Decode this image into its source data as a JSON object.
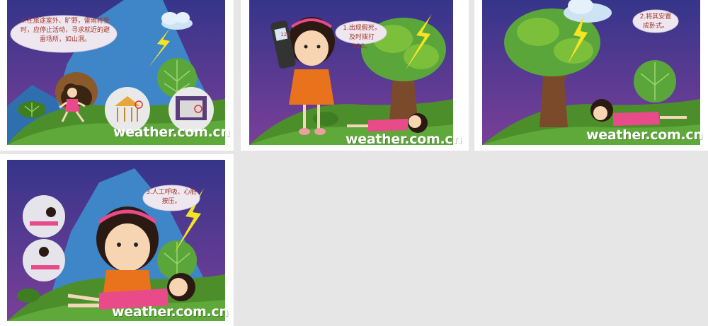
{
  "panels": [
    {
      "caption": "4.在旅途室外、旷野，雷雨将至时，应停止活动，寻求就近的避雷场所，如山洞。",
      "watermark": "weather.com.cn"
    },
    {
      "caption": "1.出现假死，及时拨打120。",
      "phone_number": "120",
      "watermark": "weather.com.cn"
    },
    {
      "caption": "2.将其安置成卧式。",
      "watermark": "weather.com.cn"
    },
    {
      "caption": "3.人工呼吸、心脏按压。",
      "watermark": "weather.com.cn"
    }
  ],
  "colors": {
    "sky_top": "#3a3a8c",
    "sky_bottom": "#6a3f94",
    "mountain": "#3f86c9",
    "grass": "#4c8f2a",
    "grass_light": "#7cbf3a",
    "caption_text": "#a0362b",
    "lightning": "#f4e421",
    "page_background": "#e6e6e6"
  }
}
